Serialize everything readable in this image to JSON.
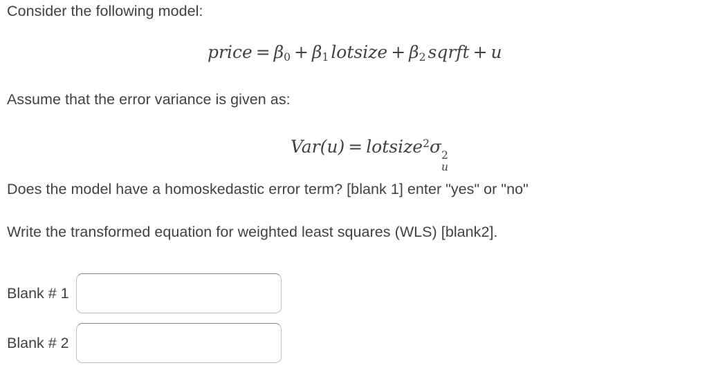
{
  "page": {
    "background_color": "#ffffff",
    "text_color": "#3f4144"
  },
  "prompt": {
    "intro_line": "Consider the following model:",
    "assume_line": "Assume that the error variance is given as:",
    "question_line": "Does the model have a homoskedastic error term? [blank 1] enter \"yes\" or \"no\"",
    "instruction_line": "Write the transformed equation for weighted least squares (WLS) [blank2]."
  },
  "equations": {
    "model": {
      "plain_text": "price = β0 + β1 lotsize + β2 sqrft + u",
      "lhs": "price",
      "equals": "=",
      "beta0": "β",
      "beta0_sub": "0",
      "plus1": "+",
      "beta1": "β",
      "beta1_sub": "1",
      "term1": "lotsize",
      "plus2": "+",
      "beta2": "β",
      "beta2_sub": "2",
      "term2": "sqrft",
      "plus3": "+",
      "error": "u"
    },
    "variance": {
      "plain_text": "Var(u) = lotsize²σ²ᵤ",
      "lhs": "Var(u)",
      "equals": "=",
      "rhs_base": "lotsize",
      "rhs_exp": "2",
      "sigma": "σ",
      "sigma_sup": "2",
      "sigma_sub": "u"
    }
  },
  "blanks": [
    {
      "label": "Blank # 1",
      "value": "",
      "placeholder": ""
    },
    {
      "label": "Blank # 2",
      "value": "",
      "placeholder": ""
    }
  ]
}
